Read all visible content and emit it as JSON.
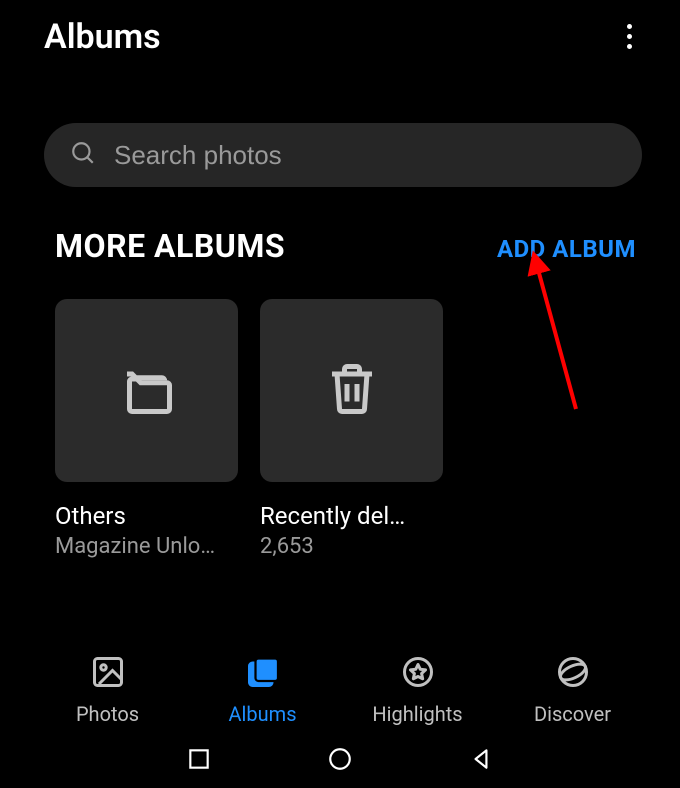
{
  "header": {
    "title": "Albums"
  },
  "search": {
    "placeholder": "Search photos"
  },
  "section": {
    "title": "MORE ALBUMS",
    "add_label": "ADD ALBUM"
  },
  "albums": [
    {
      "name": "Others",
      "sub": "Magazine Unlo…",
      "icon": "folder"
    },
    {
      "name": "Recently del…",
      "sub": "2,653",
      "icon": "trash"
    }
  ],
  "nav": [
    {
      "label": "Photos",
      "icon": "photos",
      "active": false
    },
    {
      "label": "Albums",
      "icon": "albums",
      "active": true
    },
    {
      "label": "Highlights",
      "icon": "highlights",
      "active": false
    },
    {
      "label": "Discover",
      "icon": "discover",
      "active": false
    }
  ],
  "accent_color": "#1f8fff"
}
